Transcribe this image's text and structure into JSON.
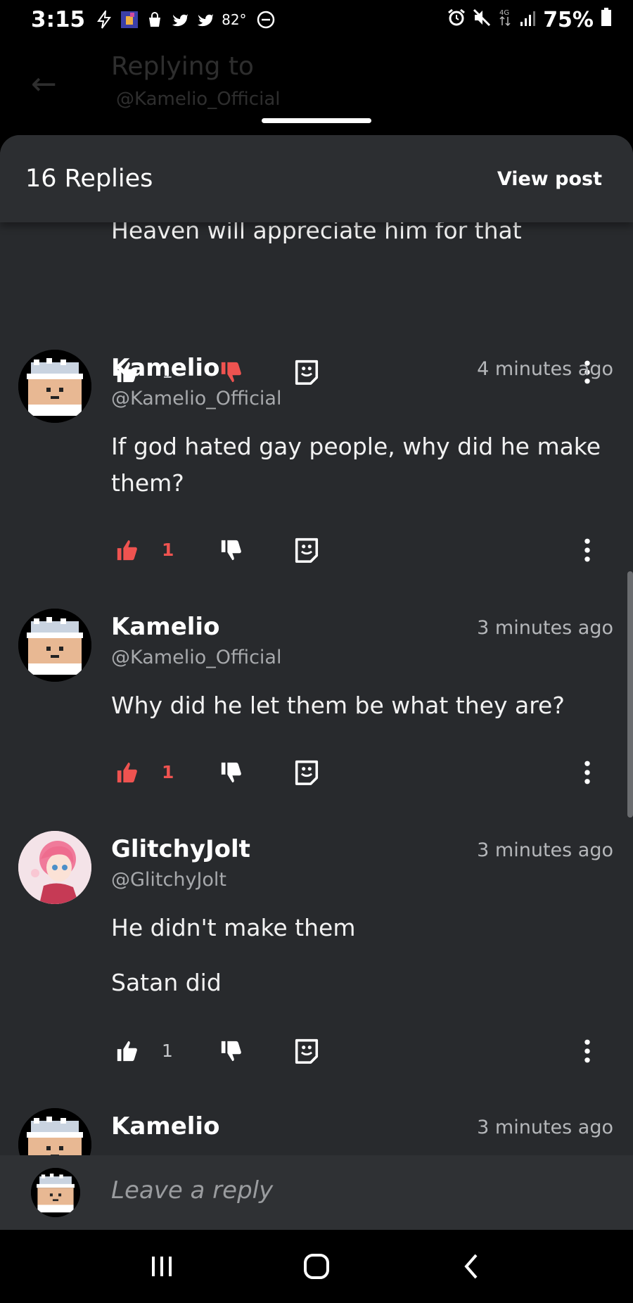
{
  "status_bar": {
    "time": "3:15",
    "temperature": "82°",
    "battery": "75%",
    "left_icons": [
      "flash-icon",
      "app-thumbnail-icon",
      "bag-icon",
      "twitter-icon",
      "twitter-icon",
      "minus-circle-icon"
    ],
    "right_icons": [
      "alarm-icon",
      "mute-icon",
      "4g-icon",
      "signal-icon",
      "battery-icon"
    ]
  },
  "background_header": {
    "title": "Replying to",
    "handle": "@Kamelio_Official"
  },
  "sheet": {
    "replies_label": "16 Replies",
    "view_post_label": "View post"
  },
  "comments": [
    {
      "body": "Heaven will appreciate him for that",
      "likes": "1",
      "liked": false,
      "disliked": true
    },
    {
      "name": "Kamelio",
      "handle": "@Kamelio_Official",
      "time": "4 minutes ago",
      "body": "If god hated gay people, why did he make them?",
      "likes": "1",
      "liked": true,
      "disliked": false
    },
    {
      "name": "Kamelio",
      "handle": "@Kamelio_Official",
      "time": "3 minutes ago",
      "body": "Why did he let them be what they are?",
      "likes": "1",
      "liked": true,
      "disliked": false
    },
    {
      "name": "GlitchyJolt",
      "handle": "@GlitchyJolt",
      "time": "3 minutes ago",
      "body_lines": [
        "He didn't make them",
        "Satan did"
      ],
      "likes": "1",
      "liked": false,
      "disliked": false
    },
    {
      "name": "Kamelio",
      "time": "3 minutes ago"
    }
  ],
  "reply_bar": {
    "placeholder": "Leave a reply"
  },
  "colors": {
    "sheet_bg": "#282a2d",
    "accent_red": "#ef5350",
    "muted_text": "#a7a9ac"
  }
}
